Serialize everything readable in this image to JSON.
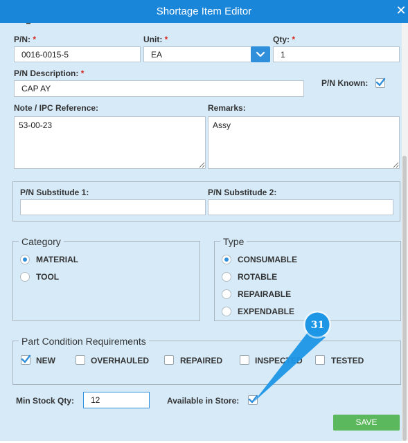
{
  "dialog": {
    "title": "Shortage Item Editor",
    "close_icon": "close-icon"
  },
  "fields": {
    "pn": {
      "label": "P/N:",
      "required": "*",
      "value": "0016-0015-5"
    },
    "unit": {
      "label": "Unit:",
      "required": "*",
      "value": "EA"
    },
    "qty": {
      "label": "Qty:",
      "required": "*",
      "value": "1"
    },
    "pn_description": {
      "label": "P/N Description:",
      "required": "*",
      "value": "CAP AY"
    },
    "pn_known": {
      "label": "P/N Known:",
      "checked": true
    },
    "note": {
      "label": "Note / IPC Reference:",
      "value": "53-00-23"
    },
    "remarks": {
      "label": "Remarks:",
      "value": "Assy"
    },
    "pn_sub1": {
      "label": "P/N Substitude 1:",
      "value": ""
    },
    "pn_sub2": {
      "label": "P/N Substitude 2:",
      "value": ""
    }
  },
  "category": {
    "legend": "Category",
    "options": [
      {
        "label": "MATERIAL",
        "selected": true
      },
      {
        "label": "TOOL",
        "selected": false
      }
    ]
  },
  "type": {
    "legend": "Type",
    "options": [
      {
        "label": "CONSUMABLE",
        "selected": true
      },
      {
        "label": "ROTABLE",
        "selected": false
      },
      {
        "label": "REPAIRABLE",
        "selected": false
      },
      {
        "label": "EXPENDABLE",
        "selected": false
      }
    ]
  },
  "condition": {
    "legend": "Part Condition Requirements",
    "options": [
      {
        "label": "NEW",
        "checked": true
      },
      {
        "label": "OVERHAULED",
        "checked": false
      },
      {
        "label": "REPAIRED",
        "checked": false
      },
      {
        "label": "INSPECTED",
        "checked": false
      },
      {
        "label": "TESTED",
        "checked": false
      }
    ]
  },
  "stock": {
    "min_label": "Min Stock Qty:",
    "min_value": "12",
    "available_label": "Available in Store:",
    "available_checked": true
  },
  "actions": {
    "save_label": "SAVE"
  },
  "annotation": {
    "step_number": "31"
  },
  "colors": {
    "titlebar": "#1a86d9",
    "panel": "#d6eaf8",
    "accent": "#2f8fdb",
    "save": "#5cb85c",
    "required": "#d9251c"
  }
}
